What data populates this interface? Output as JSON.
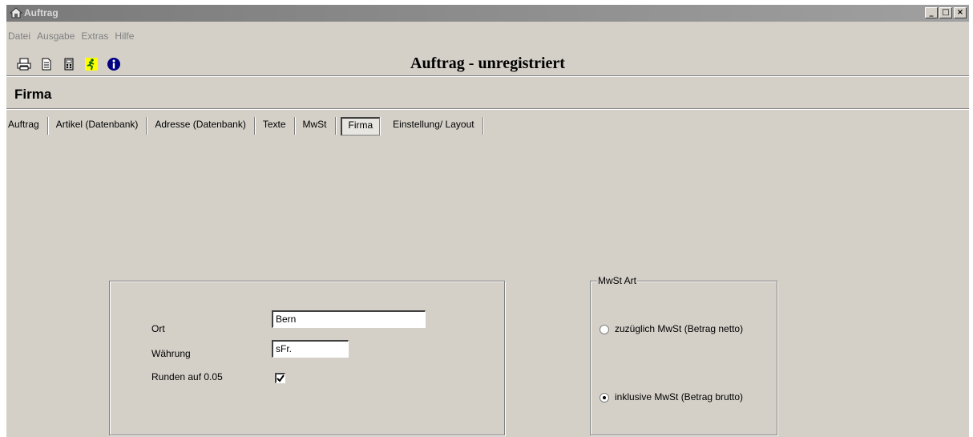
{
  "window": {
    "title": "Auftrag",
    "controls": {
      "minimize": "_",
      "maximize": "□",
      "close": "×"
    }
  },
  "menu": [
    "Datei",
    "Ausgabe",
    "Extras",
    "Hilfe"
  ],
  "toolbar": {
    "icons": [
      "print-icon",
      "document-icon",
      "calculator-icon",
      "exit-icon",
      "info-icon"
    ]
  },
  "app_heading": "Auftrag - unregistriert",
  "section_title": "Firma",
  "tabs": [
    "Auftrag",
    "Artikel (Datenbank)",
    "Adresse (Datenbank)",
    "Texte",
    "MwSt",
    "Firma",
    "Einstellung/ Layout"
  ],
  "active_tab": "Firma",
  "firma": {
    "ort_label": "Ort",
    "ort_value": "Bern",
    "waehrung_label": "Währung",
    "waehrung_value": "sFr.",
    "runden_label": "Runden auf 0.05",
    "runden_checked": true
  },
  "mwst_art": {
    "legend": "MwSt Art",
    "option_netto": "zuzüglich MwSt (Betrag netto)",
    "option_brutto": "inklusive MwSt (Betrag brutto)",
    "selected": "brutto"
  }
}
